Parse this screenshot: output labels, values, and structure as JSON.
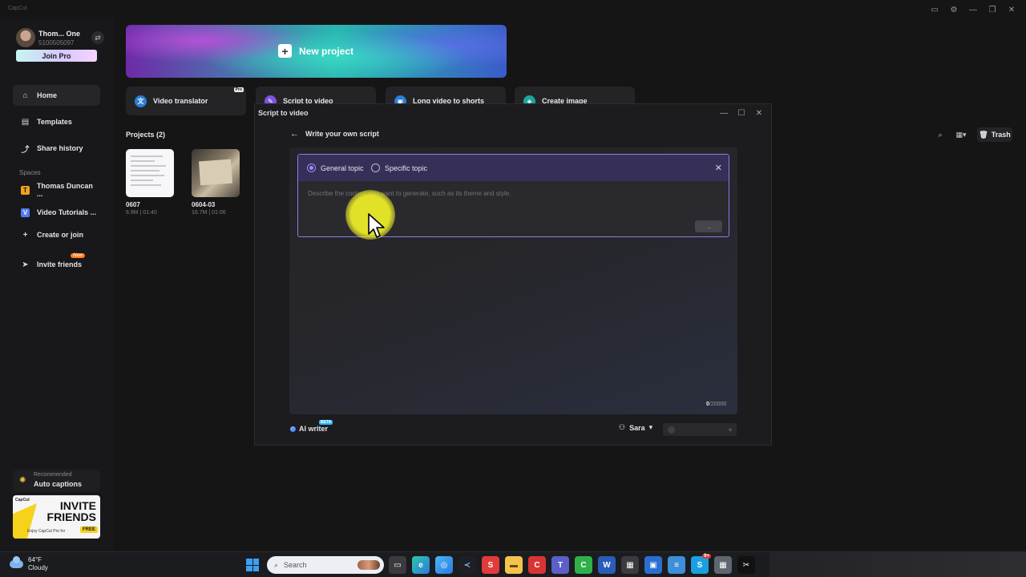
{
  "app": {
    "logo_text": "CapCut"
  },
  "profile": {
    "name": "Thom... One",
    "id": "5100505097",
    "join_pro": "Join Pro"
  },
  "nav": {
    "home": "Home",
    "templates": "Templates",
    "share_history": "Share history",
    "spaces_label": "Spaces",
    "space1": "Thomas Duncan ...",
    "space1_badge": "T",
    "space2": "Video Tutorials ...",
    "space2_badge": "V",
    "create_join": "Create or join",
    "invite": "Invite friends",
    "invite_badge": "New"
  },
  "recommended": {
    "label": "Recommended",
    "title": "Auto captions"
  },
  "invite_banner": {
    "brand": "CapCut",
    "title": "INVITE FRIENDS",
    "sub": "Enjoy CapCut Pro for",
    "free": "FREE"
  },
  "main": {
    "new_project": "New project",
    "tools": {
      "video_translator": "Video translator",
      "pro_tag": "Pro",
      "script_to_video": "Script to video",
      "long_video": "Long video to shorts",
      "create_image": "Create image"
    },
    "projects_title": "Projects  (2)",
    "projects": [
      {
        "name": "0607",
        "meta": "6.9M | 01:40"
      },
      {
        "name": "0604-03",
        "meta": "16.7M | 01:06"
      }
    ],
    "trash": "Trash"
  },
  "modal": {
    "title": "Script to video",
    "back_label": "Write your own script",
    "general_topic": "General topic",
    "specific_topic": "Specific topic",
    "placeholder": "Describe the content you want to generate, such as its theme and style.",
    "char_count_current": "0",
    "char_count_max": "/20000",
    "ai_writer": "AI writer",
    "beta": "BETA",
    "voice": "Sara"
  },
  "taskbar": {
    "temperature": "64°F",
    "condition": "Cloudy",
    "search_placeholder": "Search",
    "notif_count": "9+"
  },
  "colors": {
    "accent": "#9c8cff",
    "topic_bar": "#363059",
    "cursor_highlight": "#ebeb28"
  }
}
